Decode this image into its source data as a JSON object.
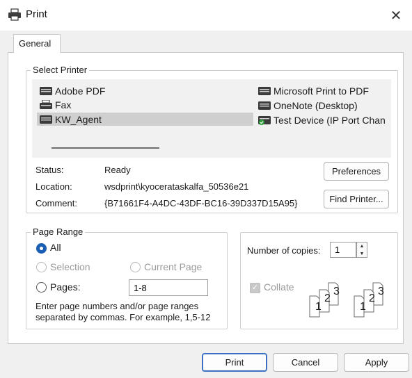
{
  "window": {
    "title": "Print",
    "close_glyph": "✕"
  },
  "tabs": [
    {
      "label": "General",
      "active": true
    }
  ],
  "select_printer": {
    "legend": "Select Printer",
    "printers": [
      {
        "name": "Adobe PDF",
        "icon": "printer-icon",
        "selected": false
      },
      {
        "name": "Fax",
        "icon": "fax-icon",
        "selected": false
      },
      {
        "name": "KW_Agent",
        "icon": "printer-icon",
        "selected": true
      },
      {
        "name": "Microsoft Print to PDF",
        "icon": "printer-icon",
        "selected": false
      },
      {
        "name": "OneNote (Desktop)",
        "icon": "printer-icon",
        "selected": false
      },
      {
        "name": "Test Device (IP Port Chan",
        "icon": "printer-default-icon",
        "selected": false
      }
    ],
    "status_label": "Status:",
    "status_value": "Ready",
    "location_label": "Location:",
    "location_value": "wsdprint\\kyocerataskalfa_50536e21",
    "comment_label": "Comment:",
    "comment_value": "{B71661F4-A4DC-43DF-BC16-39D337D15A95}",
    "preferences_button": "Preferences",
    "find_printer_button": "Find Printer..."
  },
  "page_range": {
    "legend": "Page Range",
    "options": {
      "all": "All",
      "selection": "Selection",
      "current_page": "Current Page",
      "pages": "Pages:"
    },
    "selected": "all",
    "pages_value": "1-8",
    "hint_line1": "Enter page numbers and/or page ranges",
    "hint_line2": "separated by commas.  For example, 1,5-12"
  },
  "copies": {
    "label": "Number of copies:",
    "value": "1",
    "collate_label": "Collate",
    "collate_checked": true,
    "collate_enabled": false,
    "collate_digits": [
      "1",
      "2",
      "3"
    ]
  },
  "footer": {
    "print_button": "Print",
    "cancel_button": "Cancel",
    "apply_button": "Apply"
  },
  "colors": {
    "accent": "#1a5fb4",
    "selection": "#cfcfcf",
    "printer_default_badge": "#2e9b3a"
  }
}
